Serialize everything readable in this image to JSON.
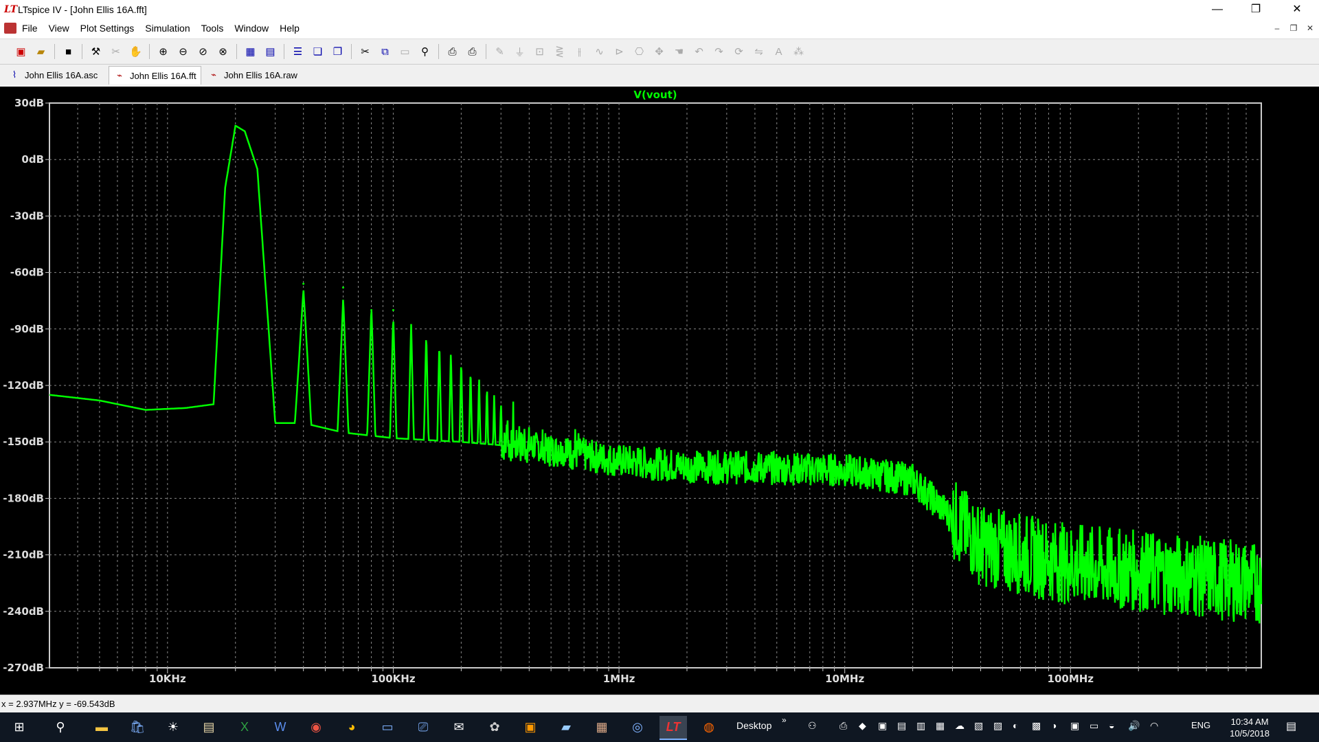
{
  "window": {
    "title": "LTspice IV - [John Ellis 16A.fft]",
    "logo_text": "LT",
    "minimize": "—",
    "maximize": "❐",
    "close": "✕"
  },
  "menu": {
    "items": [
      "File",
      "View",
      "Plot Settings",
      "Simulation",
      "Tools",
      "Window",
      "Help"
    ],
    "mdi_minimize": "–",
    "mdi_restore": "❐",
    "mdi_close": "✕"
  },
  "toolbar": {
    "icons": [
      "new-schematic",
      "open",
      "save",
      "control-panel",
      "cut-wire",
      "pan",
      "zoom-in",
      "zoom-out",
      "zoom-back",
      "zoom-fit",
      "autorange",
      "add-plot-pane",
      "add-traces",
      "delete-traces",
      "cut",
      "copy",
      "paste",
      "find",
      "print-setup",
      "print",
      "draw-wire",
      "ground",
      "label-net",
      "resistor",
      "capacitor",
      "inductor",
      "diode",
      "component",
      "move",
      "drag",
      "undo",
      "redo",
      "rotate",
      "mirror",
      "text",
      "spice-directive"
    ]
  },
  "tabs": [
    {
      "label": "John Ellis 16A.asc",
      "icon": "schematic-icon",
      "active": false
    },
    {
      "label": "John Ellis 16A.fft",
      "icon": "waveform-icon",
      "active": true
    },
    {
      "label": "John Ellis 16A.raw",
      "icon": "waveform-icon",
      "active": false
    }
  ],
  "chart_data": {
    "type": "line",
    "title": "V(vout)",
    "xscale": "log",
    "xlim": [
      3000,
      700000000
    ],
    "ylim": [
      -270,
      30
    ],
    "x_tick_labels": [
      "10KHz",
      "100KHz",
      "1MHz",
      "10MHz",
      "100MHz"
    ],
    "x_ticks": [
      10000,
      100000,
      1000000,
      10000000,
      100000000
    ],
    "y_tick_labels": [
      "30dB",
      "0dB",
      "-30dB",
      "-60dB",
      "-90dB",
      "-120dB",
      "-150dB",
      "-180dB",
      "-210dB",
      "-240dB",
      "-270dB"
    ],
    "y_ticks": [
      30,
      0,
      -30,
      -60,
      -90,
      -120,
      -150,
      -180,
      -210,
      -240,
      -270
    ],
    "grid": true,
    "background": "#000000",
    "trace_color": "#00ff00",
    "series": [
      {
        "name": "V(vout)",
        "x": [
          3000,
          5000,
          8000,
          12000,
          16000,
          18000,
          20000,
          22000,
          25000,
          30000,
          40000,
          60000,
          100000,
          200000,
          400000,
          700000,
          1000000,
          2000000,
          5000000,
          10000000,
          20000000,
          40000000,
          100000000,
          700000000
        ],
        "y": [
          -125,
          -128,
          -133,
          -132,
          -130,
          -15,
          18,
          15,
          -5,
          -140,
          -140,
          -145,
          -148,
          -150,
          -153,
          -157,
          -160,
          -163,
          -164,
          -165,
          -170,
          -205,
          -215,
          -225
        ],
        "harmonic_peaks_x": [
          40000,
          60000,
          80000,
          100000
        ],
        "harmonic_peaks_y": [
          -66,
          -68,
          -80,
          -80
        ]
      }
    ]
  },
  "status": {
    "readout": "x = 2.937MHz   y = -69.543dB"
  },
  "taskbar": {
    "desktop_label": "Desktop",
    "chevron": "»",
    "language": "ENG",
    "time": "10:34 AM",
    "date": "10/5/2018"
  }
}
